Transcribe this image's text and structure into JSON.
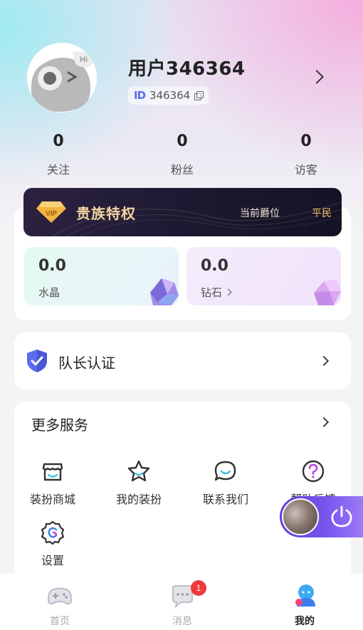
{
  "profile": {
    "username": "用户346364",
    "id_prefix": "ID",
    "user_id": "346364"
  },
  "stats": [
    {
      "value": "0",
      "label": "关注"
    },
    {
      "value": "0",
      "label": "粉丝"
    },
    {
      "value": "0",
      "label": "访客"
    }
  ],
  "vip": {
    "badge_text": "VIP",
    "title": "贵族特权",
    "rank_label": "当前爵位",
    "rank_value": "平民",
    "accent_color": "#f3c468"
  },
  "balances": {
    "crystal": {
      "value": "0.0",
      "label": "水晶"
    },
    "diamond": {
      "value": "0.0",
      "label": "钻石"
    }
  },
  "captain": {
    "label": "队长认证"
  },
  "services": {
    "title": "更多服务",
    "items": [
      {
        "label": "装扮商城",
        "icon": "store-icon"
      },
      {
        "label": "我的装扮",
        "icon": "star-icon"
      },
      {
        "label": "联系我们",
        "icon": "chat-icon"
      },
      {
        "label": "帮助反馈",
        "icon": "help-icon"
      },
      {
        "label": "设置",
        "icon": "settings-icon"
      }
    ]
  },
  "tabbar": {
    "items": [
      {
        "label": "首页",
        "icon": "gamepad-icon"
      },
      {
        "label": "消息",
        "icon": "message-icon",
        "badge": "1"
      },
      {
        "label": "我的",
        "icon": "profile-icon",
        "active": true
      }
    ]
  },
  "colors": {
    "brand_purple": "#7b58f0",
    "badge_red": "#f0393b",
    "icon_blue": "#5b6cf0"
  }
}
